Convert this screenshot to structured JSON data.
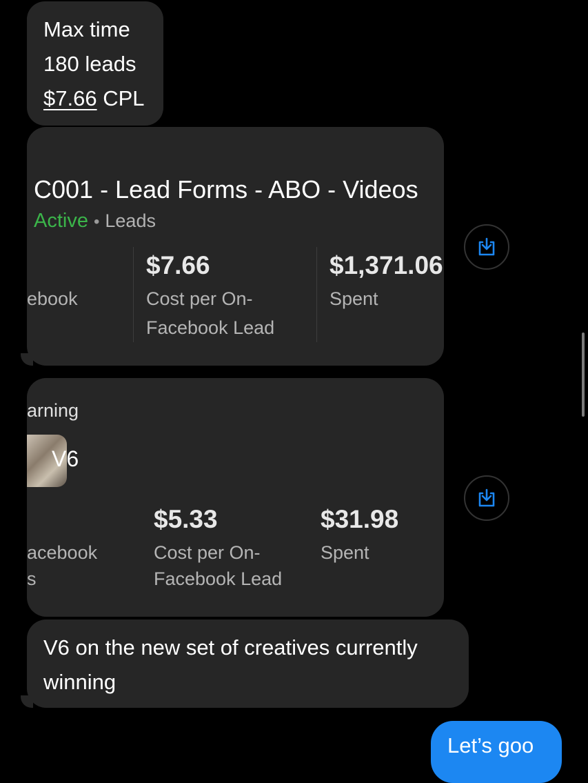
{
  "messages": {
    "first": {
      "line1": "Max time",
      "line2": "180 leads",
      "line3_amount": "$7.66",
      "line3_suffix": " CPL"
    },
    "campaign_card": {
      "title": "C001 - Lead Forms - ABO - Videos",
      "status": "Active",
      "separator": "•",
      "type": "Leads",
      "metric1_label_partial": "ebook",
      "metric2_value": "$7.66",
      "metric2_label_line1": "Cost per On-",
      "metric2_label_line2": "Facebook Lead",
      "metric3_value": "$1,371.06",
      "metric3_label": "Spent"
    },
    "ad_card": {
      "status_partial": "arning",
      "ad_name": "V6",
      "metric1_label_line1": "acebook",
      "metric1_label_line2": "s",
      "metric2_value": "$5.33",
      "metric2_label_line1": "Cost per On-",
      "metric2_label_line2": "Facebook Lead",
      "metric3_value": "$31.98",
      "metric3_label": "Spent"
    },
    "comment": {
      "line1": "V6 on the new set of creatives currently",
      "line2": "winning"
    },
    "reply": {
      "text": "Let’s goo"
    }
  },
  "icons": {
    "share": "share-download-icon"
  },
  "colors": {
    "background": "#000000",
    "bubble": "#262626",
    "active": "#3bb54a",
    "sent": "#1c87f2",
    "share_icon": "#1c87f2"
  }
}
